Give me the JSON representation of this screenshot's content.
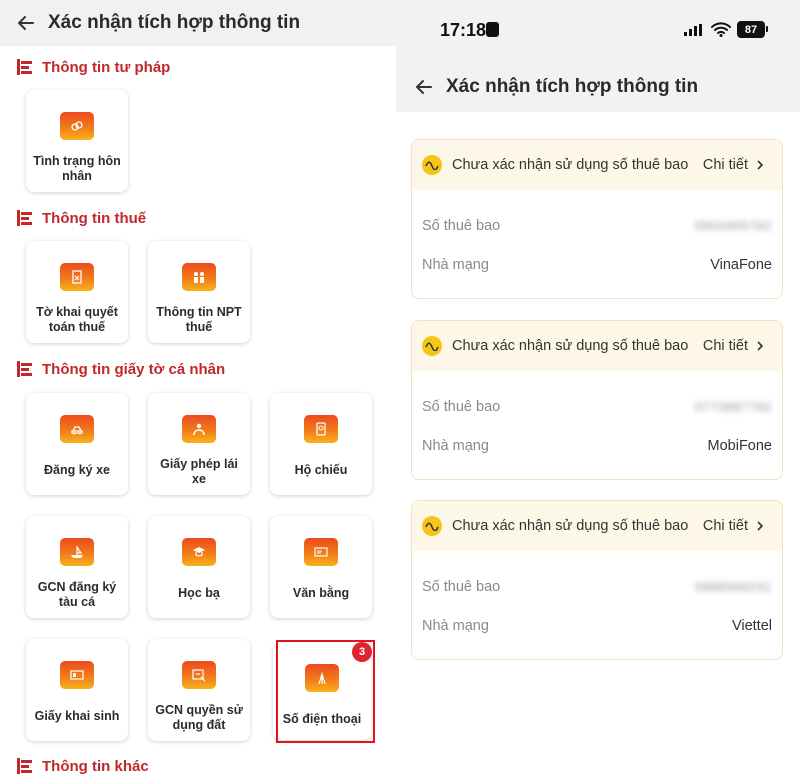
{
  "left": {
    "header_title": "Xác nhận tích hợp thông tin",
    "sections": {
      "judicial": "Thông tin tư pháp",
      "tax": "Thông tin thuế",
      "personal_docs": "Thông tin giấy tờ cá nhân",
      "other": "Thông tin khác"
    },
    "tiles": {
      "marital_l1": "Tình trạng hôn",
      "marital_l2": "nhân",
      "tax_decl_l1": "Tờ khai quyết",
      "tax_decl_l2": "toán thuế",
      "npt_l1": "Thông tin NPT",
      "npt_l2": "thuế",
      "vehicle": "Đăng ký xe",
      "license_l1": "Giấy phép lái",
      "license_l2": "xe",
      "passport": "Hộ chiếu",
      "fishing_l1": "GCN đăng ký",
      "fishing_l2": "tàu cá",
      "transcript": "Học bạ",
      "diploma": "Văn bằng",
      "birth": "Giấy khai sinh",
      "land_l1": "GCN quyền sử",
      "land_l2": "dụng đất",
      "phone": "Số điện thoại"
    },
    "phone_badge": "3"
  },
  "right": {
    "status": {
      "time": "17:18",
      "battery": "87"
    },
    "header_title": "Xác nhận tích hợp thông tin",
    "cards": [
      {
        "status_text": "Chưa xác nhận sử dụng số thuê bao",
        "detail_link": "Chi tiết",
        "subscriber_label": "Số thuê bao",
        "subscriber_value": "0903405782",
        "carrier_label": "Nhà mạng",
        "carrier_value": "VinaFone"
      },
      {
        "status_text": "Chưa xác nhận sử dụng số thuê bao",
        "detail_link": "Chi tiết",
        "subscriber_label": "Số thuê bao",
        "subscriber_value": "0773867792",
        "carrier_label": "Nhà mạng",
        "carrier_value": "MobiFone"
      },
      {
        "status_text": "Chưa xác nhận sử dụng số thuê bao",
        "detail_link": "Chi tiết",
        "subscriber_label": "Số thuê bao",
        "subscriber_value": "0986568241",
        "carrier_label": "Nhà mạng",
        "carrier_value": "Viettel"
      }
    ]
  },
  "colors": {
    "accent_red": "#c0282a",
    "highlight_red": "#e3131b",
    "warning_yellow": "#f5c518",
    "card_header_bg": "#fdf7e7"
  }
}
